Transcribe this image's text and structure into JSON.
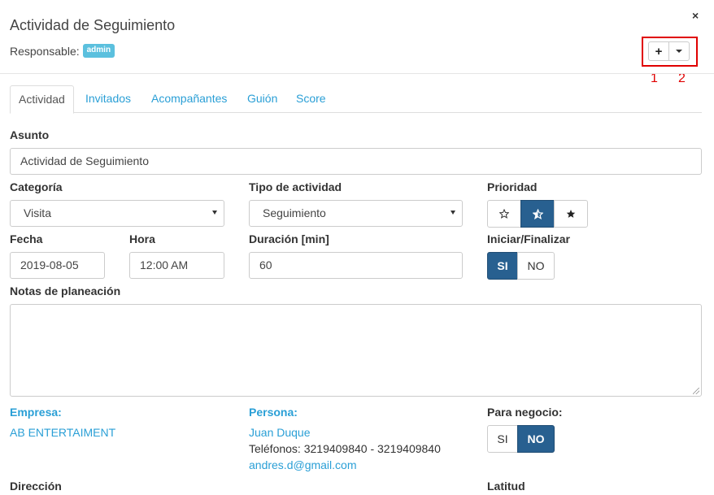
{
  "modal": {
    "title": "Actividad de Seguimiento",
    "close": "×",
    "responsable_label": "Responsable:",
    "responsable_badge": "admin"
  },
  "header_buttons": {
    "plus": "+",
    "annotation_1": "1",
    "annotation_2": "2"
  },
  "tabs": [
    {
      "label": "Actividad",
      "active": true
    },
    {
      "label": "Invitados"
    },
    {
      "label": "Acompañantes"
    },
    {
      "label": "Guión"
    },
    {
      "label": "Score"
    }
  ],
  "form": {
    "asunto": {
      "label": "Asunto",
      "value": "Actividad de Seguimiento"
    },
    "categoria": {
      "label": "Categoría",
      "value": "Visita"
    },
    "tipo": {
      "label": "Tipo de actividad",
      "value": "Seguimiento"
    },
    "prioridad": {
      "label": "Prioridad",
      "icons": [
        "star-empty-icon",
        "star-half-icon",
        "star-full-icon"
      ],
      "selected_index": 1
    },
    "fecha": {
      "label": "Fecha",
      "value": "2019-08-05"
    },
    "hora": {
      "label": "Hora",
      "value": "12:00 AM"
    },
    "duracion": {
      "label": "Duración [min]",
      "value": "60"
    },
    "iniciar": {
      "label": "Iniciar/Finalizar",
      "si": "SI",
      "no": "NO",
      "selected": "SI"
    },
    "notas": {
      "label": "Notas de planeación",
      "value": ""
    },
    "empresa": {
      "label": "Empresa:",
      "value": "AB ENTERTAIMENT"
    },
    "persona": {
      "label": "Persona:",
      "name": "Juan Duque",
      "telefonos": "Teléfonos: 3219409840 - 3219409840",
      "email": "andres.d@gmail.com"
    },
    "negocio": {
      "label": "Para negocio:",
      "si": "SI",
      "no": "NO",
      "selected": "NO"
    },
    "direccion": {
      "label": "Dirección"
    },
    "latitud": {
      "label": "Latitud"
    }
  },
  "colors": {
    "link": "#2a9fd6",
    "active_button": "#286090",
    "annotation": "#e00000",
    "badge": "#5bc0de"
  }
}
